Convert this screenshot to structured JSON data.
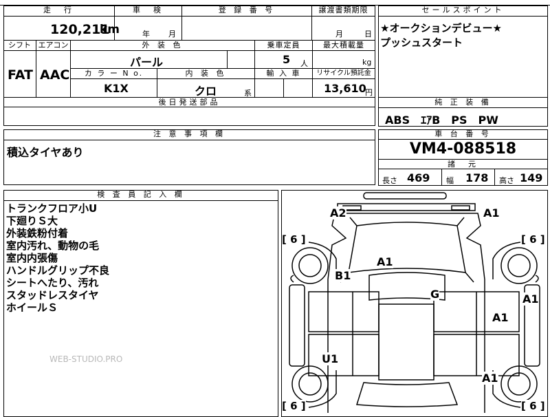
{
  "top": {
    "mileage_label": "走　行",
    "mileage_value": "120,211",
    "mileage_unit": "km",
    "inspection_label": "車　検",
    "inspection_year": "年",
    "inspection_month": "月",
    "registration_label": "登 録 番 号",
    "transfer_label": "譲渡書類期限",
    "transfer_month": "月",
    "transfer_day": "日"
  },
  "spec": {
    "shift_label": "シフト",
    "shift_value": "FAT",
    "ac_label": "エアコン",
    "ac_value": "AAC",
    "exterior_label": "外 装 色",
    "exterior_value": "パール",
    "capacity_label": "乗車定員",
    "capacity_value": "5",
    "capacity_unit": "人",
    "max_load_label": "最大積載量",
    "max_load_unit": "kg",
    "color_no_label": "カ ラ ー N o.",
    "color_no_value": "K1X",
    "interior_label": "内 装 色",
    "interior_value": "クロ",
    "interior_suffix": "系",
    "import_label": "輸 入 車",
    "recycle_label": "リサイクル預託金",
    "recycle_value": "13,610",
    "recycle_unit": "円",
    "later_parts_label": "後日発送部品"
  },
  "sales": {
    "label": "セールスポイント",
    "lines": [
      "★オークションデビュー★",
      "プッシュスタート"
    ]
  },
  "equipment": {
    "label": "純 正 装 備",
    "value": "ABS　ｴｱB　PS　PW"
  },
  "notes": {
    "label": "注 意 事 項 欄",
    "value": "積込タイヤあり"
  },
  "chassis": {
    "label": "車 台 番 号",
    "value": "VM4-088518"
  },
  "dimensions": {
    "label": "諸　元",
    "length_label": "長さ",
    "length_value": "469",
    "width_label": "幅",
    "width_value": "178",
    "height_label": "高さ",
    "height_value": "149"
  },
  "inspector": {
    "label": "検 査 員 記 入 欄",
    "lines": [
      "トランクフロア小U",
      "下廻りＳ大",
      "外装鉄粉付着",
      "室内汚れ、動物の毛",
      "室内内張傷",
      "ハンドルグリップ不良",
      "シートへたり、汚れ",
      "スタッドレスタイヤ",
      "ホイールＳ"
    ],
    "watermark": "WEB-STUDIO.PRO"
  },
  "diagram": {
    "tire_tl": "[ 6 ]",
    "tire_tr": "[ 6 ]",
    "tire_bl": "[ 6 ]",
    "tire_br": "[ 6 ]",
    "mark_a2": "A2",
    "mark_a1_top": "A1",
    "mark_a1_roof": "A1",
    "mark_b1": "B1",
    "mark_g": "G",
    "mark_a1_right": "A1",
    "mark_a1_door": "A1",
    "mark_u1": "U1",
    "mark_a1_rear": "A1"
  }
}
